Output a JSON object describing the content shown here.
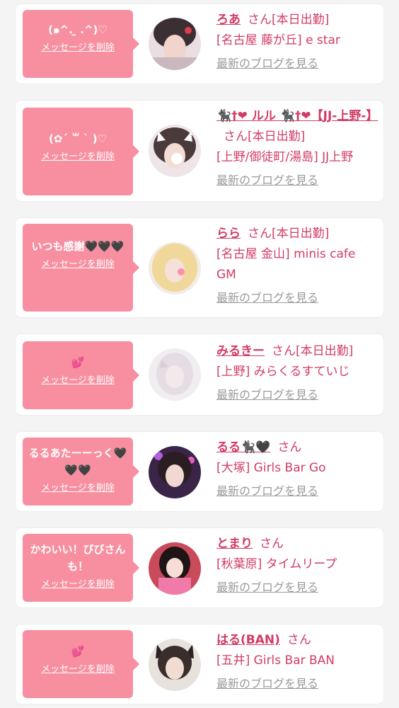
{
  "list": {
    "delete_label": "メッセージを削除",
    "blog_label": "最新のブログを見る",
    "honorific": "さん",
    "items": [
      {
        "message": "(๑^. ̫ .^)♡",
        "name": "ろあ",
        "status": "[本日出勤]",
        "shop": "[名古屋 藤が丘] e star"
      },
      {
        "message": "(✿´ ꒳ ` )♡",
        "name": "🐈‍⬛†❤ ルル 🐈‍⬛†❤【JJ-上野-】",
        "status": "[本日出勤]",
        "shop": "[上野/御徒町/湯島] JJ上野"
      },
      {
        "message": "いつも感謝🖤🖤🖤",
        "name": "らら",
        "status": "[本日出勤]",
        "shop": "[名古屋 金山] minis cafe GM"
      },
      {
        "message": "💕",
        "name": "みるきー",
        "status": "[本日出勤]",
        "shop": "[上野] みらくるすていじ"
      },
      {
        "message": "るるあたーーっく🖤🖤🖤",
        "name": "るる🐈‍⬛🖤",
        "status": "",
        "shop": "[大塚] Girls Bar Go"
      },
      {
        "message": "かわいい！びびさんも！",
        "name": "とまり",
        "status": "",
        "shop": "[秋葉原] タイムリープ"
      },
      {
        "message": "💕",
        "name": "はる(BAN)",
        "status": "",
        "shop": "[五井] Girls Bar BAN"
      }
    ]
  },
  "colors": {
    "accent": "#d33b63",
    "bubble": "#f78fa0",
    "link_gray": "#9a9a9a",
    "background": "#f4f4f4"
  }
}
